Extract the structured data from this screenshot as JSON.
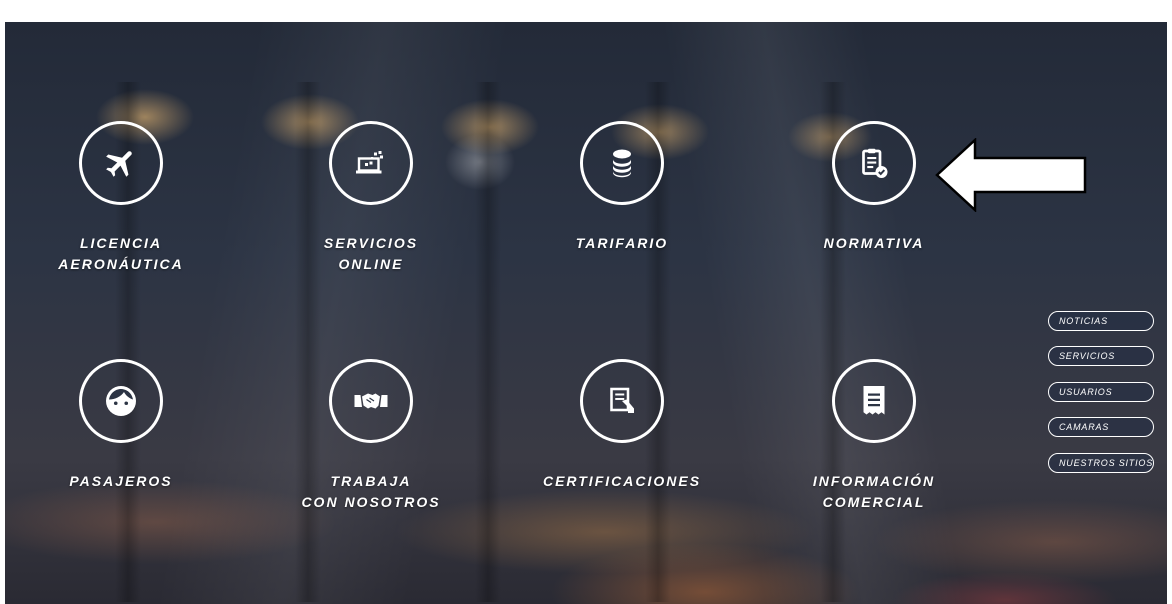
{
  "tiles": [
    {
      "label": "LICENCIA\nAERONÁUTICA",
      "icon": "airplane-icon"
    },
    {
      "label": "SERVICIOS\nONLINE",
      "icon": "laptop-upload-icon"
    },
    {
      "label": "TARIFARIO",
      "icon": "coins-icon"
    },
    {
      "label": "NORMATIVA",
      "icon": "clipboard-check-icon"
    },
    {
      "label": "PASAJEROS",
      "icon": "person-face-icon"
    },
    {
      "label": "TRABAJA\nCON NOSOTROS",
      "icon": "handshake-icon"
    },
    {
      "label": "CERTIFICACIONES",
      "icon": "certificate-icon"
    },
    {
      "label": "INFORMACIÓN\nCOMERCIAL",
      "icon": "receipt-icon"
    }
  ],
  "side_menu": [
    "NOTICIAS",
    "SERVICIOS",
    "USUARIOS",
    "CAMARAS",
    "NUESTROS SITIOS"
  ],
  "colors": {
    "icon_line": "#ffffff",
    "side_button_border": "#ffffff",
    "annotation_arrow_fill": "#ffffff"
  }
}
